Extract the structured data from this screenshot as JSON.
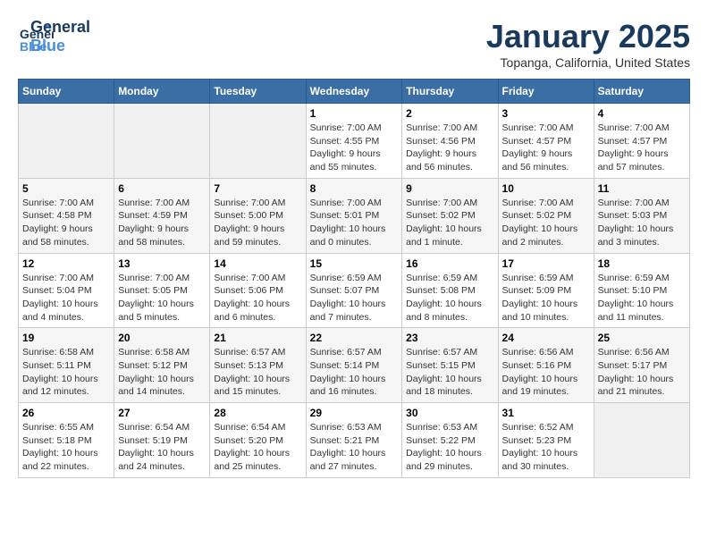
{
  "header": {
    "logo_general": "General",
    "logo_blue": "Blue",
    "month": "January 2025",
    "location": "Topanga, California, United States"
  },
  "weekdays": [
    "Sunday",
    "Monday",
    "Tuesday",
    "Wednesday",
    "Thursday",
    "Friday",
    "Saturday"
  ],
  "weeks": [
    [
      {
        "day": "",
        "info": ""
      },
      {
        "day": "",
        "info": ""
      },
      {
        "day": "",
        "info": ""
      },
      {
        "day": "1",
        "info": "Sunrise: 7:00 AM\nSunset: 4:55 PM\nDaylight: 9 hours\nand 55 minutes."
      },
      {
        "day": "2",
        "info": "Sunrise: 7:00 AM\nSunset: 4:56 PM\nDaylight: 9 hours\nand 56 minutes."
      },
      {
        "day": "3",
        "info": "Sunrise: 7:00 AM\nSunset: 4:57 PM\nDaylight: 9 hours\nand 56 minutes."
      },
      {
        "day": "4",
        "info": "Sunrise: 7:00 AM\nSunset: 4:57 PM\nDaylight: 9 hours\nand 57 minutes."
      }
    ],
    [
      {
        "day": "5",
        "info": "Sunrise: 7:00 AM\nSunset: 4:58 PM\nDaylight: 9 hours\nand 58 minutes."
      },
      {
        "day": "6",
        "info": "Sunrise: 7:00 AM\nSunset: 4:59 PM\nDaylight: 9 hours\nand 58 minutes."
      },
      {
        "day": "7",
        "info": "Sunrise: 7:00 AM\nSunset: 5:00 PM\nDaylight: 9 hours\nand 59 minutes."
      },
      {
        "day": "8",
        "info": "Sunrise: 7:00 AM\nSunset: 5:01 PM\nDaylight: 10 hours\nand 0 minutes."
      },
      {
        "day": "9",
        "info": "Sunrise: 7:00 AM\nSunset: 5:02 PM\nDaylight: 10 hours\nand 1 minute."
      },
      {
        "day": "10",
        "info": "Sunrise: 7:00 AM\nSunset: 5:02 PM\nDaylight: 10 hours\nand 2 minutes."
      },
      {
        "day": "11",
        "info": "Sunrise: 7:00 AM\nSunset: 5:03 PM\nDaylight: 10 hours\nand 3 minutes."
      }
    ],
    [
      {
        "day": "12",
        "info": "Sunrise: 7:00 AM\nSunset: 5:04 PM\nDaylight: 10 hours\nand 4 minutes."
      },
      {
        "day": "13",
        "info": "Sunrise: 7:00 AM\nSunset: 5:05 PM\nDaylight: 10 hours\nand 5 minutes."
      },
      {
        "day": "14",
        "info": "Sunrise: 7:00 AM\nSunset: 5:06 PM\nDaylight: 10 hours\nand 6 minutes."
      },
      {
        "day": "15",
        "info": "Sunrise: 6:59 AM\nSunset: 5:07 PM\nDaylight: 10 hours\nand 7 minutes."
      },
      {
        "day": "16",
        "info": "Sunrise: 6:59 AM\nSunset: 5:08 PM\nDaylight: 10 hours\nand 8 minutes."
      },
      {
        "day": "17",
        "info": "Sunrise: 6:59 AM\nSunset: 5:09 PM\nDaylight: 10 hours\nand 10 minutes."
      },
      {
        "day": "18",
        "info": "Sunrise: 6:59 AM\nSunset: 5:10 PM\nDaylight: 10 hours\nand 11 minutes."
      }
    ],
    [
      {
        "day": "19",
        "info": "Sunrise: 6:58 AM\nSunset: 5:11 PM\nDaylight: 10 hours\nand 12 minutes."
      },
      {
        "day": "20",
        "info": "Sunrise: 6:58 AM\nSunset: 5:12 PM\nDaylight: 10 hours\nand 14 minutes."
      },
      {
        "day": "21",
        "info": "Sunrise: 6:57 AM\nSunset: 5:13 PM\nDaylight: 10 hours\nand 15 minutes."
      },
      {
        "day": "22",
        "info": "Sunrise: 6:57 AM\nSunset: 5:14 PM\nDaylight: 10 hours\nand 16 minutes."
      },
      {
        "day": "23",
        "info": "Sunrise: 6:57 AM\nSunset: 5:15 PM\nDaylight: 10 hours\nand 18 minutes."
      },
      {
        "day": "24",
        "info": "Sunrise: 6:56 AM\nSunset: 5:16 PM\nDaylight: 10 hours\nand 19 minutes."
      },
      {
        "day": "25",
        "info": "Sunrise: 6:56 AM\nSunset: 5:17 PM\nDaylight: 10 hours\nand 21 minutes."
      }
    ],
    [
      {
        "day": "26",
        "info": "Sunrise: 6:55 AM\nSunset: 5:18 PM\nDaylight: 10 hours\nand 22 minutes."
      },
      {
        "day": "27",
        "info": "Sunrise: 6:54 AM\nSunset: 5:19 PM\nDaylight: 10 hours\nand 24 minutes."
      },
      {
        "day": "28",
        "info": "Sunrise: 6:54 AM\nSunset: 5:20 PM\nDaylight: 10 hours\nand 25 minutes."
      },
      {
        "day": "29",
        "info": "Sunrise: 6:53 AM\nSunset: 5:21 PM\nDaylight: 10 hours\nand 27 minutes."
      },
      {
        "day": "30",
        "info": "Sunrise: 6:53 AM\nSunset: 5:22 PM\nDaylight: 10 hours\nand 29 minutes."
      },
      {
        "day": "31",
        "info": "Sunrise: 6:52 AM\nSunset: 5:23 PM\nDaylight: 10 hours\nand 30 minutes."
      },
      {
        "day": "",
        "info": ""
      }
    ]
  ]
}
